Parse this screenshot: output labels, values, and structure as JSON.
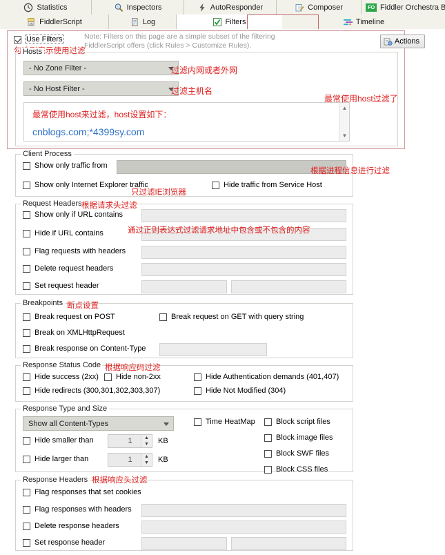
{
  "tabs": {
    "row1": [
      {
        "label": "Statistics",
        "icon": "clock-icon"
      },
      {
        "label": "Inspectors",
        "icon": "magnifier-icon"
      },
      {
        "label": "AutoResponder",
        "icon": "bolt-icon"
      },
      {
        "label": "Composer",
        "icon": "pencil-pad-icon"
      },
      {
        "label": "Fiddler Orchestra Beta",
        "icon": "fo-badge-icon"
      }
    ],
    "row2": [
      {
        "label": "FiddlerScript",
        "icon": "js-scroll-icon"
      },
      {
        "label": "Log",
        "icon": "document-icon"
      },
      {
        "label": "Filters",
        "icon": "green-check-icon",
        "active": true
      },
      {
        "label": "Timeline",
        "icon": "timeline-icon"
      }
    ]
  },
  "header": {
    "use_filters_label": "Use Filters",
    "note_line1": "Note: Filters on this page are a simple subset of the filtering",
    "note_line2": "FiddlerScript offers (click Rules > Customize Rules).",
    "actions_label": "Actions"
  },
  "hosts": {
    "caption": "Hosts",
    "zone_filter": "- No Zone Filter -",
    "host_filter": "- No Host Filter -",
    "textarea_line1": "最常使用host来过滤，host设置如下：",
    "textarea_line2": "cnblogs.com;*4399sy.com"
  },
  "client_process": {
    "caption": "Client Process",
    "show_only_traffic_from": "Show only traffic from",
    "process_value": "",
    "show_only_ie": "Show only Internet Explorer traffic",
    "hide_service_host": "Hide traffic from Service Host"
  },
  "request_headers": {
    "caption": "Request Headers",
    "show_only_if_url": "Show only if URL contains",
    "hide_if_url": "Hide if URL contains",
    "flag_requests": "Flag requests with headers",
    "delete_request_headers": "Delete request headers",
    "set_request_header": "Set request header",
    "values": {
      "show_only_if_url": "",
      "hide_if_url": "",
      "flag_requests": "",
      "delete_request_headers": "",
      "set_request_header_name": "",
      "set_request_header_value": ""
    }
  },
  "breakpoints": {
    "caption": "Breakpoints",
    "break_post": "Break request on POST",
    "break_get": "Break request on GET with query string",
    "break_xhr": "Break on XMLHttpRequest",
    "break_content_type": "Break response on Content-Type",
    "content_type_value": ""
  },
  "response_status": {
    "caption": "Response Status Code",
    "hide_success": "Hide success (2xx)",
    "hide_non2xx": "Hide non-2xx",
    "hide_auth": "Hide Authentication demands (401,407)",
    "hide_redirects": "Hide redirects (300,301,302,303,307)",
    "hide_not_modified": "Hide Not Modified (304)"
  },
  "response_type": {
    "caption": "Response Type and Size",
    "content_types": "Show all Content-Types",
    "hide_smaller": "Hide smaller than",
    "hide_larger": "Hide larger than",
    "smaller_value": "1",
    "larger_value": "1",
    "kb_unit": "KB",
    "time_heatmap": "Time HeatMap",
    "block_script": "Block script files",
    "block_image": "Block image files",
    "block_swf": "Block SWF files",
    "block_css": "Block CSS files"
  },
  "response_headers": {
    "caption": "Response Headers",
    "flag_cookies": "Flag responses that set cookies",
    "flag_with_headers": "Flag responses with headers",
    "delete_headers": "Delete response headers",
    "set_header": "Set response header",
    "values": {
      "flag_with_headers": "",
      "delete_headers": "",
      "set_header_name": "",
      "set_header_value": ""
    }
  },
  "annotations": {
    "use_filters": "勾选则表示使用过滤",
    "zone": "过滤内网或者外网",
    "host": "过滤主机名",
    "host_common": "最常使用host过滤了",
    "process": "根据进程信息进行过滤",
    "ie_only": "只过滤IE浏览器",
    "req_headers": "根据请求头过滤",
    "regex_url": "通过正则表达式过滤请求地址中包含或不包含的内容",
    "breakpoints": "断点设置",
    "status_code": "根据响应码过滤",
    "resp_headers": "根据响应头过滤"
  },
  "colors": {
    "annotation_red": "#e02020",
    "host_blue": "#2f72c8",
    "accent_green": "#2aa84a",
    "tab_bg": "#f3f2ea"
  }
}
